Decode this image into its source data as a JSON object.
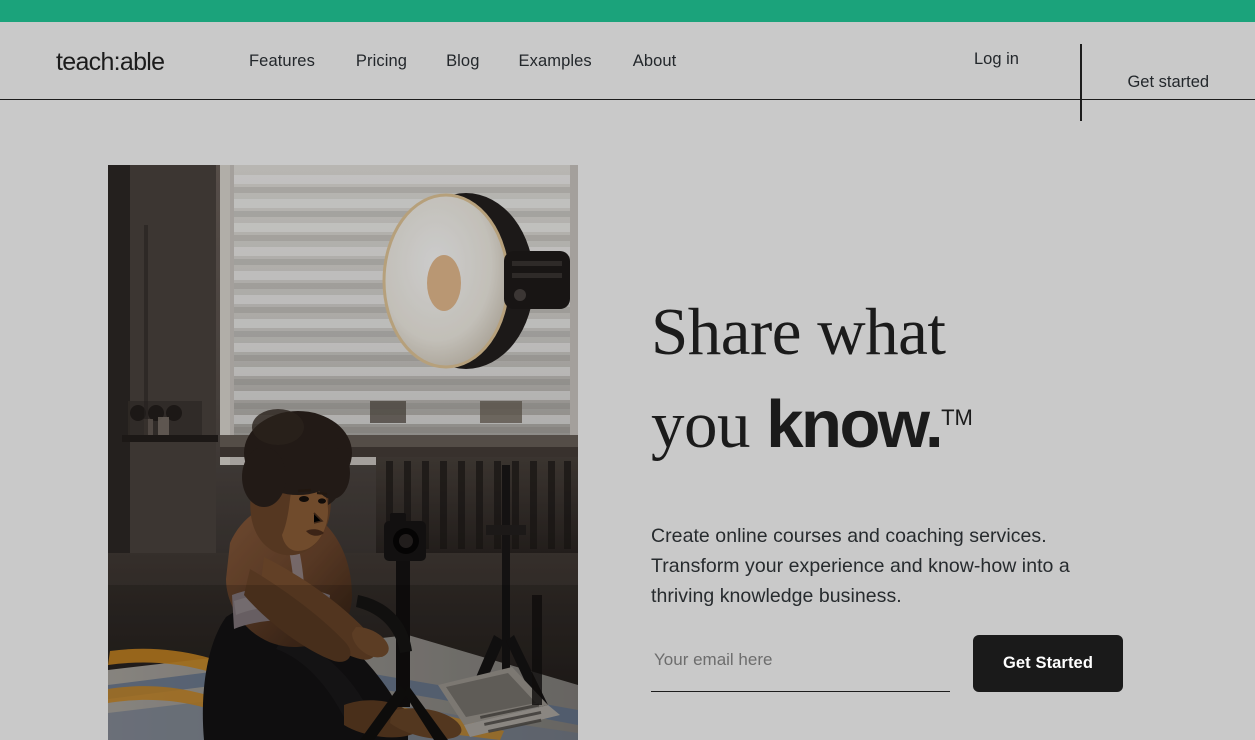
{
  "theme": {
    "accent_green": "#1ba37b",
    "page_background": "#c9c9c9",
    "text_dark": "#1c1c1c",
    "button_dark": "#1a1a1a"
  },
  "header": {
    "logo": "teach:able",
    "nav": [
      {
        "label": "Features"
      },
      {
        "label": "Pricing"
      },
      {
        "label": "Blog"
      },
      {
        "label": "Examples"
      },
      {
        "label": "About"
      }
    ],
    "login_label": "Log in",
    "get_started_label": "Get started"
  },
  "hero": {
    "headline_line1": "Share what",
    "headline_line2_serif": "you ",
    "headline_line2_bold": "know.",
    "trademark": "TM",
    "subcopy": "Create online courses and coaching services. Transform your experience and know-how into a thriving knowledge business.",
    "image_alt": "Woman in athletic wear sitting on a patterned yoga mat in a studio, facing a camera on a tripod with a beauty-dish studio light and a laptop",
    "form": {
      "email_placeholder": "Your email here",
      "email_value": "",
      "submit_label": "Get Started"
    }
  }
}
